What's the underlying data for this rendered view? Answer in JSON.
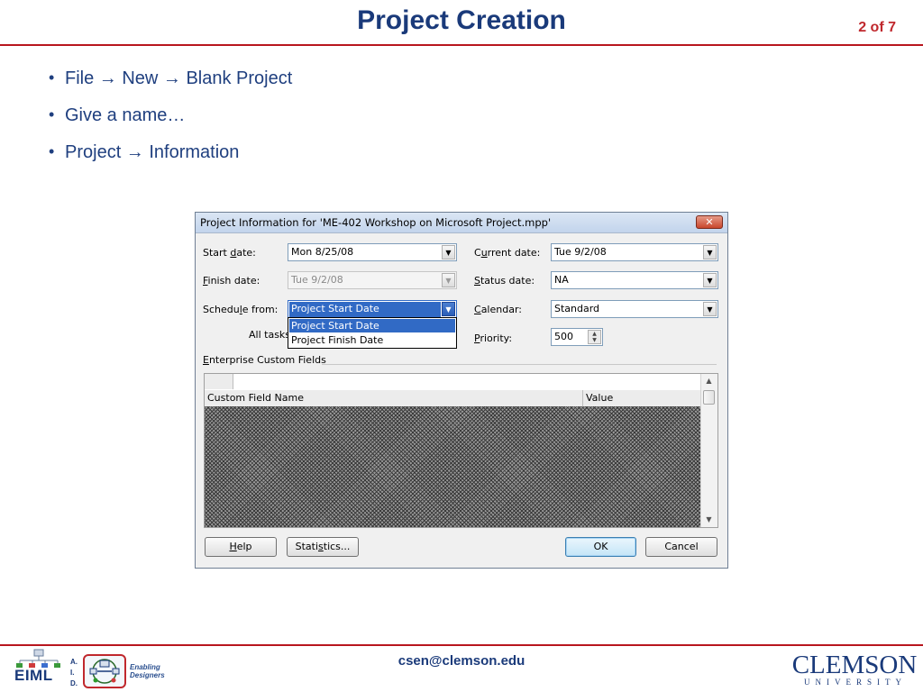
{
  "slide": {
    "title": "Project Creation",
    "page_number": "2 of 7",
    "bullets": [
      "File → New → Blank Project",
      "Give a name…",
      "Project → Information"
    ],
    "footer_email": "csen@clemson.edu"
  },
  "dialog": {
    "title": "Project Information for 'ME-402 Workshop on Microsoft Project.mpp'",
    "close_glyph": "✕",
    "start_date": {
      "label_pre": "Start ",
      "label_key": "d",
      "label_post": "ate:",
      "value": "Mon 8/25/08"
    },
    "finish_date": {
      "label_key": "F",
      "label_post": "inish date:",
      "value": "Tue 9/2/08"
    },
    "schedule_from": {
      "label_pre": "Schedu",
      "label_key": "l",
      "label_post": "e from:",
      "value": "Project Start Date",
      "options": [
        "Project Start Date",
        "Project Finish Date"
      ]
    },
    "all_tasks_label": "All tasks",
    "current_date": {
      "label_pre": "C",
      "label_key": "u",
      "label_post": "rrent date:",
      "value": "Tue 9/2/08"
    },
    "status_date": {
      "label_key": "S",
      "label_post": "tatus date:",
      "value": "NA"
    },
    "calendar": {
      "label_key": "C",
      "label_post": "alendar:",
      "value": "Standard"
    },
    "priority": {
      "label_key": "P",
      "label_post": "riority:",
      "value": "500"
    },
    "enterprise_fields": {
      "label_key": "E",
      "label_post": "nterprise Custom Fields",
      "col_name": "Custom Field Name",
      "col_value": "Value"
    },
    "buttons": {
      "help": {
        "key": "H",
        "rest": "elp"
      },
      "statistics": {
        "pre": "Stati",
        "key": "s",
        "post": "tics..."
      },
      "ok": "OK",
      "cancel": "Cancel"
    }
  },
  "footer_logos": {
    "eiml": "EIML",
    "aid_letters": [
      "A.",
      "I.",
      "D."
    ],
    "enabling_line1": "Enabling",
    "enabling_line2": "Designers",
    "clemson": "CLEMSON",
    "university": "UNIVERSITY"
  },
  "colors": {
    "title_blue": "#1a3a7a",
    "accent_red": "#b8161e",
    "selection_blue": "#316ac5"
  }
}
